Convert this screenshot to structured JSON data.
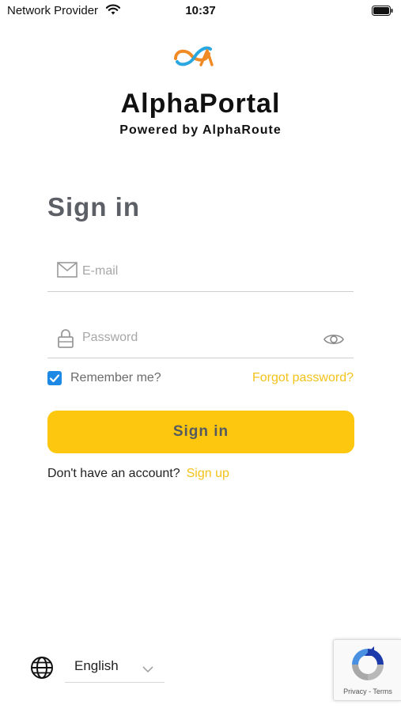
{
  "status_bar": {
    "carrier": "Network Provider",
    "time": "10:37",
    "wifi_icon": "wifi-icon",
    "battery_icon": "battery-icon"
  },
  "brand": {
    "app_name": "AlphaPortal",
    "powered_by": "Powered by AlphaRoute",
    "logo_icon": "alphaportal-logo-icon",
    "colors": {
      "orange": "#f08a24",
      "blue": "#2aa7e0"
    }
  },
  "form": {
    "title": "Sign in",
    "email": {
      "placeholder": "E-mail",
      "value": "",
      "icon": "mail-icon"
    },
    "password": {
      "placeholder": "Password",
      "value": "",
      "icon": "lock-icon",
      "toggle_icon": "eye-icon"
    },
    "remember": {
      "label": "Remember me?",
      "checked": true
    },
    "forgot_label": "Forgot password?",
    "submit_label": "Sign in",
    "no_account_text": "Don't have an account?",
    "signup_label": "Sign up"
  },
  "language": {
    "selected": "English",
    "icon": "globe-icon",
    "chevron_icon": "chevron-down-icon"
  },
  "recaptcha": {
    "links": "Privacy - Terms",
    "icon": "recaptcha-icon"
  },
  "theme": {
    "accent": "#fdc70f",
    "link": "#f3c21a",
    "checkbox": "#1e88e5",
    "title_gray": "#5c5f66"
  }
}
